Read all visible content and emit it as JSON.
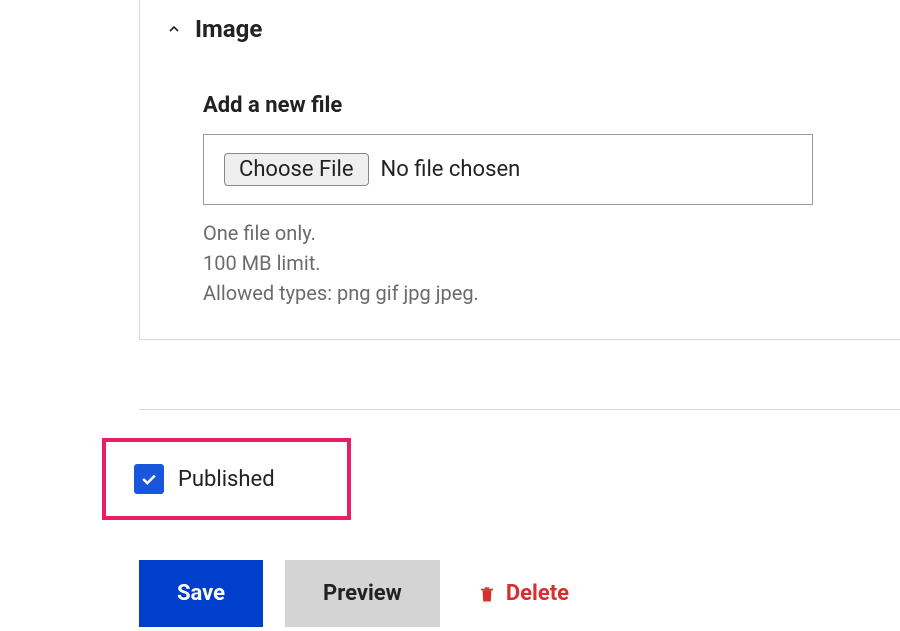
{
  "panel": {
    "title": "Image",
    "file_field": {
      "label": "Add a new file",
      "choose_button": "Choose File",
      "status": "No file chosen",
      "hints": [
        "One file only.",
        "100 MB limit.",
        "Allowed types: png gif jpg jpeg."
      ]
    }
  },
  "published": {
    "label": "Published",
    "checked": true
  },
  "actions": {
    "save": "Save",
    "preview": "Preview",
    "delete": "Delete"
  }
}
